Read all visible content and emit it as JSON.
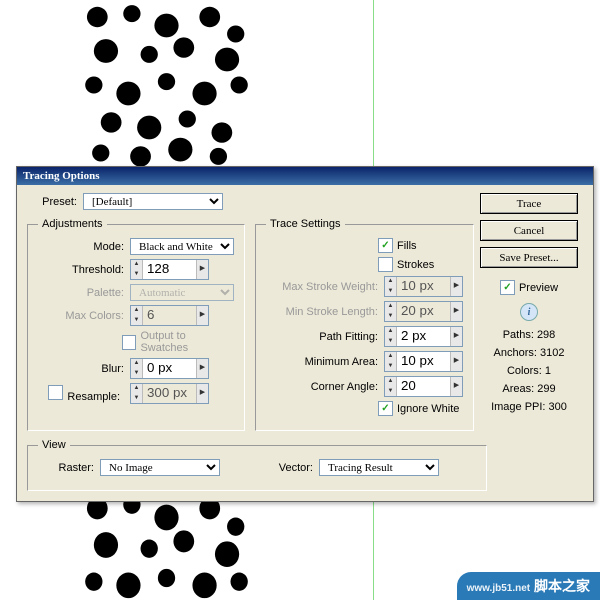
{
  "dialog_title": "Tracing Options",
  "preset": {
    "label": "Preset:",
    "value": "[Default]"
  },
  "adjustments": {
    "legend": "Adjustments",
    "mode": {
      "label": "Mode:",
      "value": "Black and White"
    },
    "threshold": {
      "label": "Threshold:",
      "value": "128"
    },
    "palette": {
      "label": "Palette:",
      "value": "Automatic"
    },
    "max_colors": {
      "label": "Max Colors:",
      "value": "6"
    },
    "output_swatches": "Output to Swatches",
    "blur": {
      "label": "Blur:",
      "value": "0 px"
    },
    "resample": {
      "label": "Resample:",
      "value": "300 px"
    }
  },
  "trace_settings": {
    "legend": "Trace Settings",
    "fills": "Fills",
    "strokes": "Strokes",
    "max_stroke_weight": {
      "label": "Max Stroke Weight:",
      "value": "10 px"
    },
    "min_stroke_length": {
      "label": "Min Stroke Length:",
      "value": "20 px"
    },
    "path_fitting": {
      "label": "Path Fitting:",
      "value": "2 px"
    },
    "minimum_area": {
      "label": "Minimum Area:",
      "value": "10 px"
    },
    "corner_angle": {
      "label": "Corner Angle:",
      "value": "20"
    },
    "ignore_white": "Ignore White"
  },
  "view": {
    "legend": "View",
    "raster": {
      "label": "Raster:",
      "value": "No Image"
    },
    "vector": {
      "label": "Vector:",
      "value": "Tracing Result"
    }
  },
  "buttons": {
    "trace": "Trace",
    "cancel": "Cancel",
    "save_preset": "Save Preset..."
  },
  "preview": "Preview",
  "stats": {
    "paths": "Paths: 298",
    "anchors": "Anchors: 3102",
    "colors": "Colors: 1",
    "areas": "Areas: 299",
    "ppi": "Image PPI: 300"
  },
  "watermark": {
    "url": "www.jb51.net",
    "name": "脚本之家"
  }
}
